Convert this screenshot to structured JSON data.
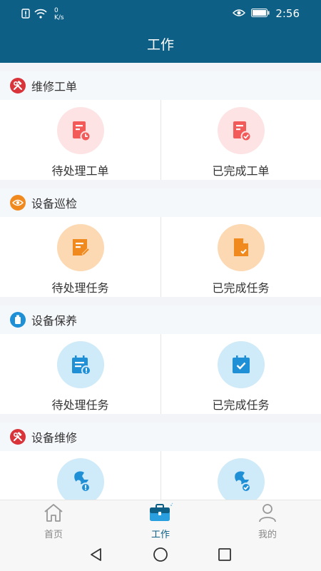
{
  "statusbar": {
    "net_value": "0",
    "net_unit": "K/s",
    "time": "2:56"
  },
  "header": {
    "title": "工作"
  },
  "sections": [
    {
      "title": "维修工单",
      "accent": "#d9343a",
      "icon": "wrench-hammer-icon",
      "cards": [
        {
          "label": "待处理工单",
          "icon": "pending-order-icon",
          "bg": "#fde3e3",
          "fg": "#f25b59"
        },
        {
          "label": "已完成工单",
          "icon": "completed-order-icon",
          "bg": "#fde3e3",
          "fg": "#f25b59"
        }
      ]
    },
    {
      "title": "设备巡检",
      "accent": "#f08a1e",
      "icon": "eye-icon",
      "cards": [
        {
          "label": "待处理任务",
          "icon": "pending-task-icon",
          "bg": "#fcd9b3",
          "fg": "#f08a1e"
        },
        {
          "label": "已完成任务",
          "icon": "completed-task-icon",
          "bg": "#fcd9b3",
          "fg": "#f08a1e"
        }
      ]
    },
    {
      "title": "设备保养",
      "accent": "#1f8fd6",
      "icon": "maintenance-icon",
      "cards": [
        {
          "label": "待处理任务",
          "icon": "pending-calendar-icon",
          "bg": "#cfeaf8",
          "fg": "#1f8fd6"
        },
        {
          "label": "已完成任务",
          "icon": "completed-calendar-icon",
          "bg": "#cfeaf8",
          "fg": "#1f8fd6"
        }
      ]
    },
    {
      "title": "设备维修",
      "accent": "#d9343a",
      "icon": "wrench-hammer-icon",
      "cards": [
        {
          "label": "",
          "icon": "pending-repair-icon",
          "bg": "#cfeaf8",
          "fg": "#1f8fd6"
        },
        {
          "label": "",
          "icon": "completed-repair-icon",
          "bg": "#cfeaf8",
          "fg": "#1f8fd6"
        }
      ]
    }
  ],
  "tabs": [
    {
      "label": "首页",
      "icon": "home-icon",
      "active": false
    },
    {
      "label": "工作",
      "icon": "briefcase-icon",
      "active": true
    },
    {
      "label": "我的",
      "icon": "user-icon",
      "active": false
    }
  ],
  "colors": {
    "primary": "#0d5f86"
  }
}
